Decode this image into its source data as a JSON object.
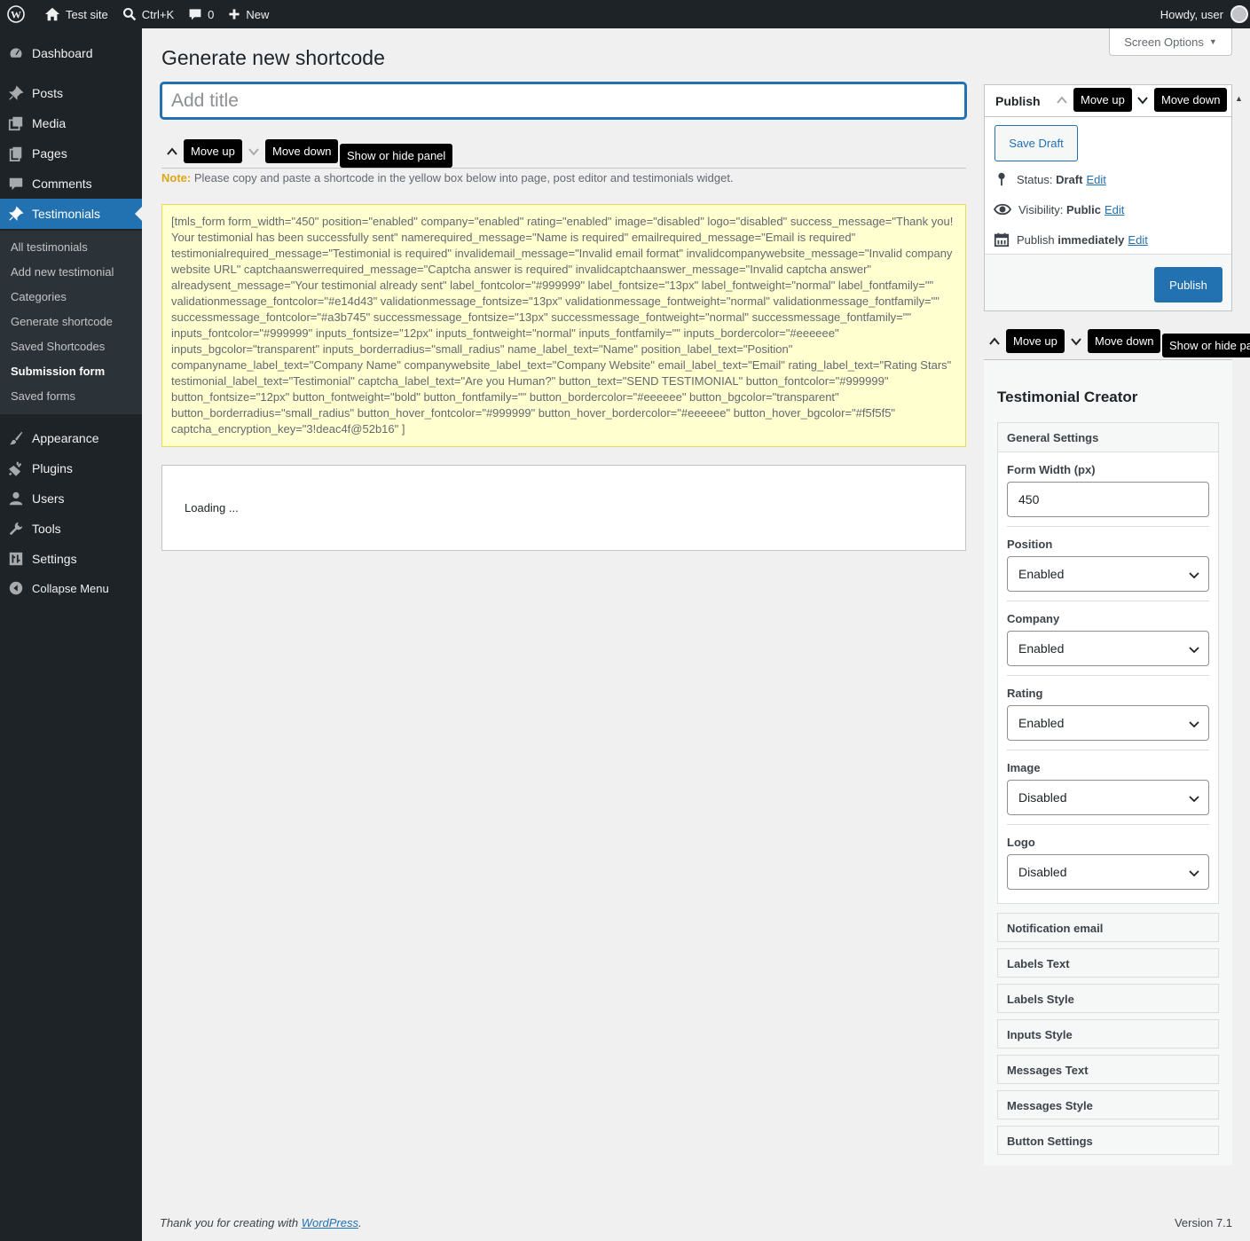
{
  "adminbar": {
    "site_name": "Test site",
    "search_shortcut": "Ctrl+K",
    "comments_count": "0",
    "new_label": "New",
    "howdy": "Howdy, user"
  },
  "sidebar": {
    "items": [
      {
        "label": "Dashboard",
        "icon": "dashboard-icon"
      },
      {
        "label": "Posts",
        "icon": "pin-icon"
      },
      {
        "label": "Media",
        "icon": "media-icon"
      },
      {
        "label": "Pages",
        "icon": "pages-icon"
      },
      {
        "label": "Comments",
        "icon": "comment-icon"
      },
      {
        "label": "Testimonials",
        "icon": "pin-icon"
      },
      {
        "label": "Appearance",
        "icon": "brush-icon"
      },
      {
        "label": "Plugins",
        "icon": "plug-icon"
      },
      {
        "label": "Users",
        "icon": "user-icon"
      },
      {
        "label": "Tools",
        "icon": "wrench-icon"
      },
      {
        "label": "Settings",
        "icon": "settings-icon"
      },
      {
        "label": "Collapse Menu",
        "icon": "collapse-icon"
      }
    ],
    "submenu": [
      "All testimonials",
      "Add new testimonial",
      "Categories",
      "Generate shortcode",
      "Saved Shortcodes",
      "Submission form",
      "Saved forms"
    ]
  },
  "screen_options": "Screen Options",
  "page_title": "Generate new shortcode",
  "title_placeholder": "Add title",
  "tooltips": {
    "move_up": "Move up",
    "move_down": "Move down",
    "show_hide": "Show or hide panel",
    "show_hide_cut": "Show or hide pa"
  },
  "note": {
    "label": "Note:",
    "text": " Please copy and paste a shortcode in the yellow box below into page, post editor and testimonials widget."
  },
  "shortcode": "[tmls_form form_width=\"450\" position=\"enabled\" company=\"enabled\" rating=\"enabled\" image=\"disabled\" logo=\"disabled\" success_message=\"Thank you! Your testimonial has been successfully sent\" namerequired_message=\"Name is required\" emailrequired_message=\"Email is required\" testimonialrequired_message=\"Testimonial is required\" invalidemail_message=\"Invalid email format\" invalidcompanywebsite_message=\"Invalid company website URL\" captchaanswerrequired_message=\"Captcha answer is required\" invalidcaptchaanswer_message=\"Invalid captcha answer\" alreadysent_message=\"Your testimonial already sent\" label_fontcolor=\"#999999\" label_fontsize=\"13px\" label_fontweight=\"normal\" label_fontfamily=\"\" validationmessage_fontcolor=\"#e14d43\" validationmessage_fontsize=\"13px\" validationmessage_fontweight=\"normal\" validationmessage_fontfamily=\"\" successmessage_fontcolor=\"#a3b745\" successmessage_fontsize=\"13px\" successmessage_fontweight=\"normal\" successmessage_fontfamily=\"\" inputs_fontcolor=\"#999999\" inputs_fontsize=\"12px\" inputs_fontweight=\"normal\" inputs_fontfamily=\"\" inputs_bordercolor=\"#eeeeee\" inputs_bgcolor=\"transparent\" inputs_borderradius=\"small_radius\" name_label_text=\"Name\" position_label_text=\"Position\" companyname_label_text=\"Company Name\" companywebsite_label_text=\"Company Website\" email_label_text=\"Email\" rating_label_text=\"Rating Stars\" testimonial_label_text=\"Testimonial\" captcha_label_text=\"Are you Human?\" button_text=\"SEND TESTIMONIAL\" button_fontcolor=\"#999999\" button_fontsize=\"12px\" button_fontweight=\"bold\" button_fontfamily=\"\" button_bordercolor=\"#eeeeee\" button_bgcolor=\"transparent\" button_borderradius=\"small_radius\" button_hover_fontcolor=\"#999999\" button_hover_bordercolor=\"#eeeeee\" button_hover_bgcolor=\"#f5f5f5\" captcha_encryption_key=\"3!deac4f@52b16\" ]",
  "loading": "Loading ...",
  "publish": {
    "title": "Publish",
    "save_draft": "Save Draft",
    "status_label": "Status:",
    "status_value": "Draft",
    "visibility_label": "Visibility:",
    "visibility_value": "Public",
    "publish_label": "Publish",
    "publish_value": "immediately",
    "edit": "Edit",
    "publish_button": "Publish"
  },
  "creator": {
    "title": "Testimonial Creator",
    "general_settings": "General Settings",
    "fields": [
      {
        "label": "Form Width (px)",
        "value": "450",
        "type": "input"
      },
      {
        "label": "Position",
        "value": "Enabled",
        "type": "select"
      },
      {
        "label": "Company",
        "value": "Enabled",
        "type": "select"
      },
      {
        "label": "Rating",
        "value": "Enabled",
        "type": "select"
      },
      {
        "label": "Image",
        "value": "Disabled",
        "type": "select"
      },
      {
        "label": "Logo",
        "value": "Disabled",
        "type": "select"
      }
    ],
    "sections": [
      "Notification email",
      "Labels Text",
      "Labels Style",
      "Inputs Style",
      "Messages Text",
      "Messages Style",
      "Button Settings"
    ]
  },
  "footer": {
    "thanks_prefix": "Thank you for creating with ",
    "wordpress_link": "WordPress",
    "thanks_suffix": ".",
    "version": "Version 7.1"
  },
  "colors": {
    "accent": "#2271b1",
    "adminbar": "#1d2327",
    "note": "#dba617",
    "shortcode_bg": "#ffffd0"
  }
}
